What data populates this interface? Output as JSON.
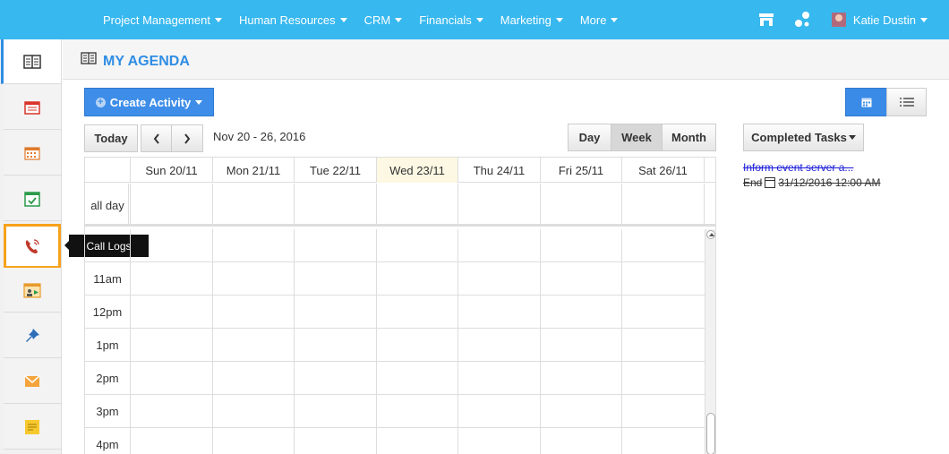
{
  "nav": {
    "items": [
      "Project Management",
      "Human Resources",
      "CRM",
      "Financials",
      "Marketing",
      "More"
    ],
    "user_name": "Katie Dustin"
  },
  "page": {
    "title": "MY AGENDA"
  },
  "toolbar": {
    "create_label": "Create Activity",
    "today_label": "Today",
    "prev_label": "‹",
    "next_label": "›",
    "date_range": "Nov 20 - 26, 2016",
    "views": [
      "Day",
      "Week",
      "Month"
    ],
    "selected_view": "Week",
    "completed_tasks_label": "Completed Tasks"
  },
  "sidebar": {
    "tooltip": "Call Logs"
  },
  "calendar": {
    "days": [
      "Sun 20/11",
      "Mon 21/11",
      "Tue 22/11",
      "Wed 23/11",
      "Thu 24/11",
      "Fri 25/11",
      "Sat 26/11"
    ],
    "today_index": 3,
    "allday_label": "all day",
    "times": [
      "",
      "11am",
      "12pm",
      "1pm",
      "2pm",
      "3pm",
      "4pm"
    ]
  },
  "tasks": [
    {
      "title": "Inform event server a...",
      "end_label": "End",
      "end_time": "31/12/2016 12:00 AM"
    }
  ],
  "colors": {
    "topbar": "#37b8ef",
    "accent": "#2f8de4",
    "focus": "#f7a21b",
    "today": "#fcf8e3"
  }
}
